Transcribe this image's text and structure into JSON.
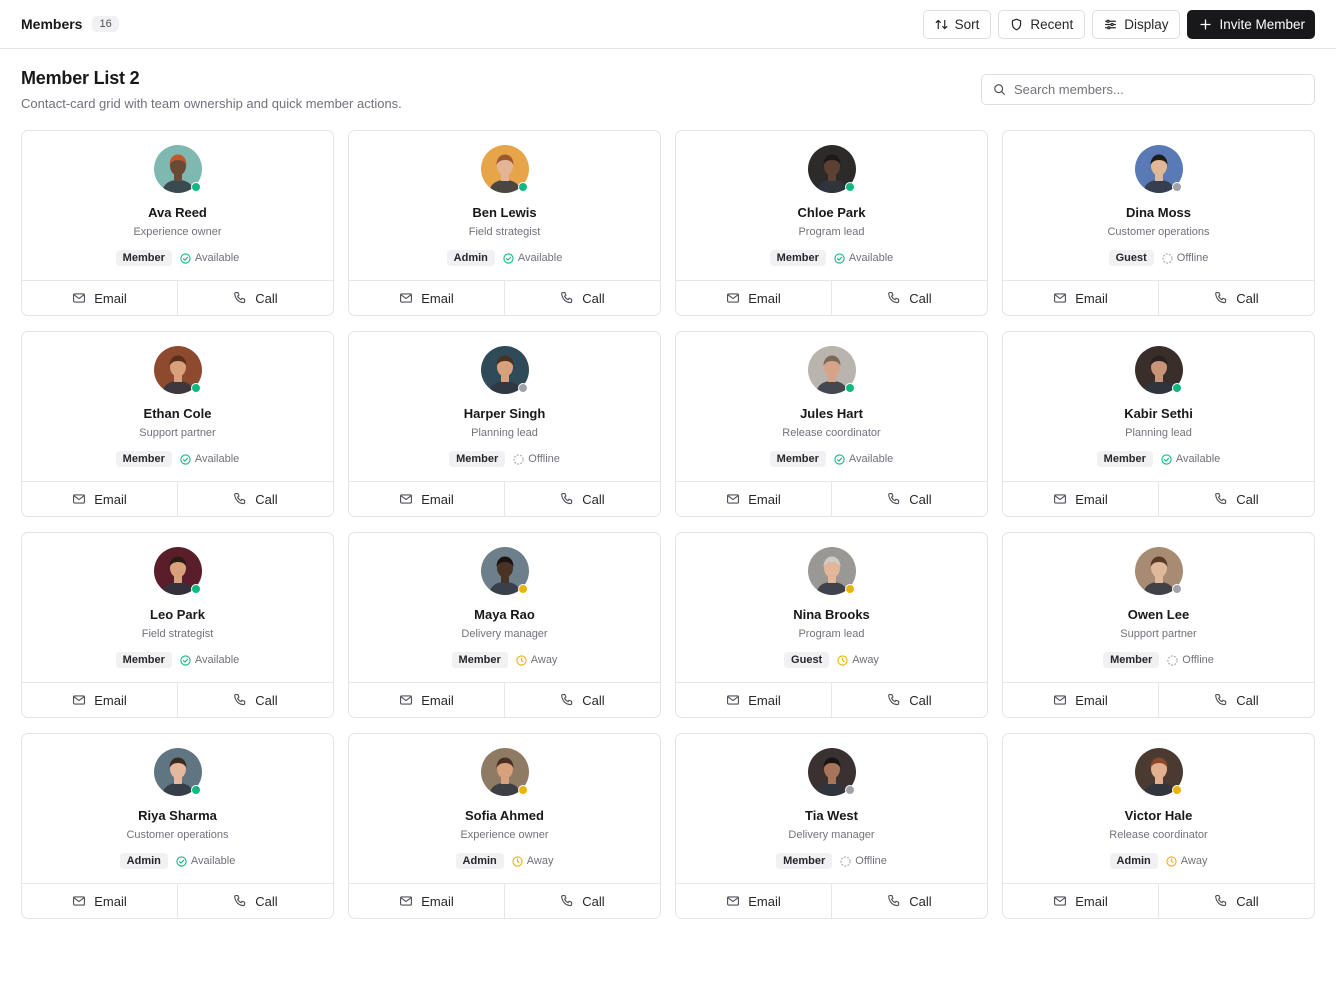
{
  "topbar": {
    "title": "Members",
    "count": "16",
    "sort_label": "Sort",
    "recent_label": "Recent",
    "display_label": "Display",
    "invite_label": "Invite Member"
  },
  "header": {
    "title": "Member List 2",
    "subtitle": "Contact-card grid with team ownership and quick member actions."
  },
  "search": {
    "placeholder": "Search members..."
  },
  "colors": {
    "available": "#10b981",
    "away": "#eab308",
    "offline": "#a1a1aa",
    "primary": "#18181b"
  },
  "actions": {
    "email_label": "Email",
    "call_label": "Call"
  },
  "members": [
    {
      "name": "Ava Reed",
      "role": "Experience owner",
      "access": "Member",
      "status": "Available",
      "bg": "#7fb8b0",
      "skin": "#6b4a35",
      "hair": "#c4572b"
    },
    {
      "name": "Ben Lewis",
      "role": "Field strategist",
      "access": "Admin",
      "status": "Available",
      "bg": "#e7a54a",
      "skin": "#e3b596",
      "hair": "#9b5a2e"
    },
    {
      "name": "Chloe Park",
      "role": "Program lead",
      "access": "Member",
      "status": "Available",
      "bg": "#2d2b2a",
      "skin": "#5c4033",
      "hair": "#1c1a19"
    },
    {
      "name": "Dina Moss",
      "role": "Customer operations",
      "access": "Guest",
      "status": "Offline",
      "bg": "#5a7ab5",
      "skin": "#e0b797",
      "hair": "#1d1d1f"
    },
    {
      "name": "Ethan Cole",
      "role": "Support partner",
      "access": "Member",
      "status": "Available",
      "bg": "#8e4a2f",
      "skin": "#d9a07c",
      "hair": "#5a2f1a"
    },
    {
      "name": "Harper Singh",
      "role": "Planning lead",
      "access": "Member",
      "status": "Offline",
      "bg": "#2f4b5a",
      "skin": "#d9a07c",
      "hair": "#4a3020"
    },
    {
      "name": "Jules Hart",
      "role": "Release coordinator",
      "access": "Member",
      "status": "Available",
      "bg": "#b9b4ad",
      "skin": "#d8a488",
      "hair": "#7a6a5a"
    },
    {
      "name": "Kabir Sethi",
      "role": "Planning lead",
      "access": "Member",
      "status": "Available",
      "bg": "#3a2e2a",
      "skin": "#c79478",
      "hair": "#2a2220"
    },
    {
      "name": "Leo Park",
      "role": "Field strategist",
      "access": "Member",
      "status": "Available",
      "bg": "#5a1e2a",
      "skin": "#d9a07c",
      "hair": "#2a1b14"
    },
    {
      "name": "Maya Rao",
      "role": "Delivery manager",
      "access": "Member",
      "status": "Away",
      "bg": "#6d7f8a",
      "skin": "#4a3224",
      "hair": "#1c1412"
    },
    {
      "name": "Nina Brooks",
      "role": "Program lead",
      "access": "Guest",
      "status": "Away",
      "bg": "#9a9894",
      "skin": "#e3b69a",
      "hair": "#cfcbc5"
    },
    {
      "name": "Owen Lee",
      "role": "Support partner",
      "access": "Member",
      "status": "Offline",
      "bg": "#a88b73",
      "skin": "#e0b89a",
      "hair": "#5a3a26"
    },
    {
      "name": "Riya Sharma",
      "role": "Customer operations",
      "access": "Admin",
      "status": "Available",
      "bg": "#5f7582",
      "skin": "#e3b89c",
      "hair": "#3a2a20"
    },
    {
      "name": "Sofia Ahmed",
      "role": "Experience owner",
      "access": "Admin",
      "status": "Away",
      "bg": "#8f7a64",
      "skin": "#d9a07c",
      "hair": "#4a3020"
    },
    {
      "name": "Tia West",
      "role": "Delivery manager",
      "access": "Member",
      "status": "Offline",
      "bg": "#3a3230",
      "skin": "#a8755a",
      "hair": "#1a1412"
    },
    {
      "name": "Victor Hale",
      "role": "Release coordinator",
      "access": "Admin",
      "status": "Away",
      "bg": "#4a3a32",
      "skin": "#e0b090",
      "hair": "#8a4a2a"
    }
  ]
}
